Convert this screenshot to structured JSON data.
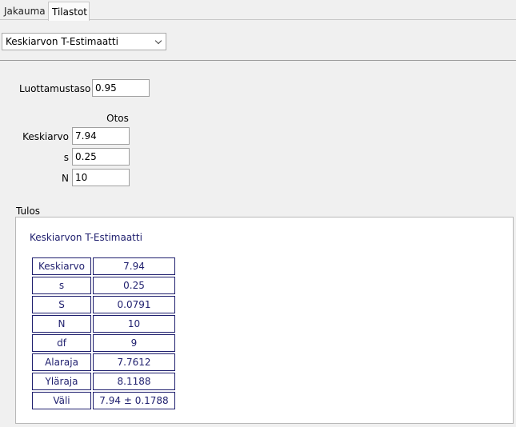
{
  "tabs": [
    {
      "label": "Jakauma",
      "active": false
    },
    {
      "label": "Tilastot",
      "active": true
    }
  ],
  "procedure": {
    "selected": "Keskiarvon T-Estimaatti"
  },
  "confidence": {
    "label": "Luottamustaso",
    "value": "0.95"
  },
  "sample": {
    "header": "Otos",
    "mean": {
      "label": "Keskiarvo",
      "value": "7.94"
    },
    "s": {
      "label": "s",
      "value": "0.25"
    },
    "n": {
      "label": "N",
      "value": "10"
    }
  },
  "result": {
    "title": "Tulos",
    "heading": "Keskiarvon T-Estimaatti",
    "rows": [
      {
        "key": "Keskiarvo",
        "value": "7.94"
      },
      {
        "key": "s",
        "value": "0.25"
      },
      {
        "key": "S",
        "value": "0.0791"
      },
      {
        "key": "N",
        "value": "10"
      },
      {
        "key": "df",
        "value": "9"
      },
      {
        "key": "Alaraja",
        "value": "7.7612"
      },
      {
        "key": "Yläraja",
        "value": "8.1188"
      },
      {
        "key": "Väli",
        "value": "7.94 ± 0.1788"
      }
    ]
  },
  "icons": {
    "dropdown": "chevron-down-icon"
  }
}
